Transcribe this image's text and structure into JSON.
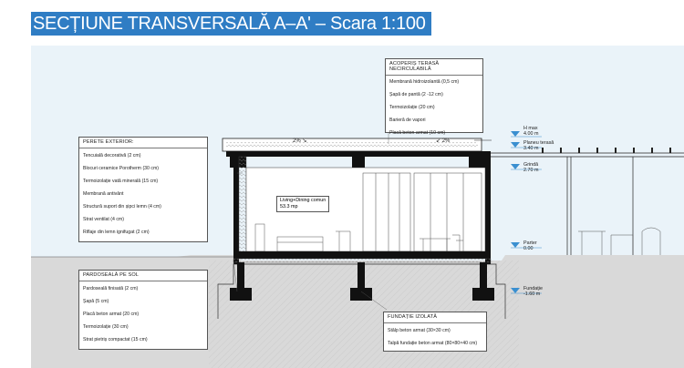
{
  "title": "SECȚIUNE TRANSVERSALĂ A–A' – Scara 1:100",
  "roof_box": {
    "heading": "ACOPERIȘ TERASĂ NECIRCULABILĂ",
    "items": [
      "Membrană hidroizolantă (0,5 cm)",
      "Șapă de pantă (2 -12 cm)",
      "Termoizolație (20 cm)",
      "Barieră de vapori",
      "Placă beton armat (10 cm)"
    ]
  },
  "wall_box": {
    "heading": "PERETE EXTERIOR:",
    "items": [
      "Tencuială decorativă (2 cm)",
      "Blocuri ceramice Porotherm (30 cm)",
      "Termoizolație vată minerală (15 cm)",
      "Membrană antivânt",
      "Structură suport din șipci lemn (4 cm)",
      "Strat ventilat (4 cm)",
      "Riflaje din lemn ignifugat (2 cm)"
    ]
  },
  "floor_box": {
    "heading": "PARDOSEALĂ PE SOL",
    "items": [
      "Pardoseală finisată (2 cm)",
      "Șapă (5 cm)",
      "Placă beton armat (20 cm)",
      "Termoizolație (30 cm)",
      "Strat pietriș compactat (15 cm)"
    ]
  },
  "foundation_box": {
    "heading": "FUNDAȚIE IZOLATĂ",
    "items": [
      "Stâlp beton armat (30×30 cm)",
      "Talpă fundație beton armat (80×80×40 cm)"
    ]
  },
  "room": {
    "name": "Living+Dining comun",
    "area": "53.3 mp"
  },
  "roof_slopes": {
    "left": "2%",
    "right": "2%"
  },
  "levels": [
    {
      "name": "H max",
      "value": "4.00 m"
    },
    {
      "name": "Planeu terasă",
      "value": "3.40 m"
    },
    {
      "name": "Grindă",
      "value": "2.70 m"
    },
    {
      "name": "Parter",
      "value": "0.00"
    },
    {
      "name": "Fundație",
      "value": "-1.60 m"
    }
  ],
  "colors": {
    "title_bg": "#2f7dc4",
    "sky": "#eaf3f9",
    "ground": "#d9d9d9",
    "marker": "#3a8fd0",
    "concrete": "#111111"
  }
}
